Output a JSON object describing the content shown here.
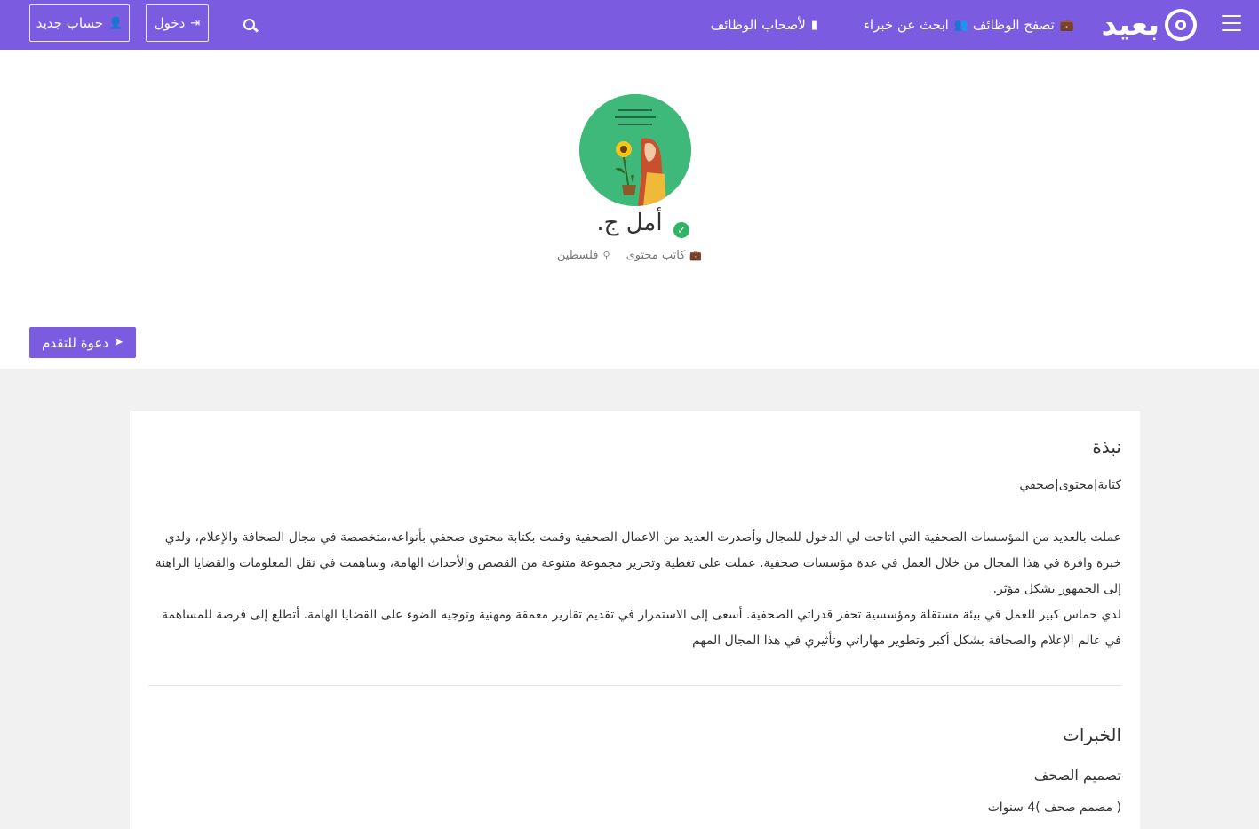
{
  "header": {
    "logo_text": "بعيد",
    "nav": [
      {
        "label": "تصفح الوظائف",
        "icon": "briefcase-icon"
      },
      {
        "label": "ابحث عن خبراء",
        "icon": "users-icon"
      },
      {
        "label": "لأصحاب الوظائف",
        "icon": "building-icon"
      }
    ],
    "login_label": "دخول",
    "signup_label": "حساب جديد",
    "brand_color": "#7b5ce0"
  },
  "profile": {
    "name": "أمل ج.",
    "job_title": "كاتب محتوى",
    "location": "فلسطين",
    "invite_label": "دعوة للتقدم",
    "verified": true
  },
  "about": {
    "title": "نبذة",
    "subtitle": "كتابة|محتوى|صحفي",
    "paragraph1": "عملت بالعديد من المؤسسات الصحفية التي اتاحت لي الدخول للمجال وأصدرت العديد من الاعمال الصحفية وقمت بكتابة محتوى صحفي بأنواعه،متخصصة في مجال الصحافة والإعلام، ولدي خبرة وافرة في هذا المجال من خلال العمل في عدة مؤسسات صحفية. عملت على تغطية وتحرير مجموعة متنوعة من القصص والأحداث الهامة، وساهمت في نقل المعلومات والقضايا الراهنة إلى الجمهور بشكل مؤثر.",
    "paragraph2": "لدي حماس كبير للعمل في بيئة مستقلة ومؤسسية تحفز قدراتي الصحفية. أسعى إلى الاستمرار في تقديم تقارير معمقة ومهنية وتوجيه الضوء على القضايا الهامة. أتطلع إلى فرصة للمساهمة في عالم الإعلام والصحافة بشكل أكبر وتطوير مهاراتي وتأثيري في هذا المجال المهم"
  },
  "experience": {
    "title": "الخبرات",
    "items": [
      {
        "name": "تصميم الصحف",
        "meta": "( مصمم صحف )4 سنوات"
      }
    ]
  }
}
